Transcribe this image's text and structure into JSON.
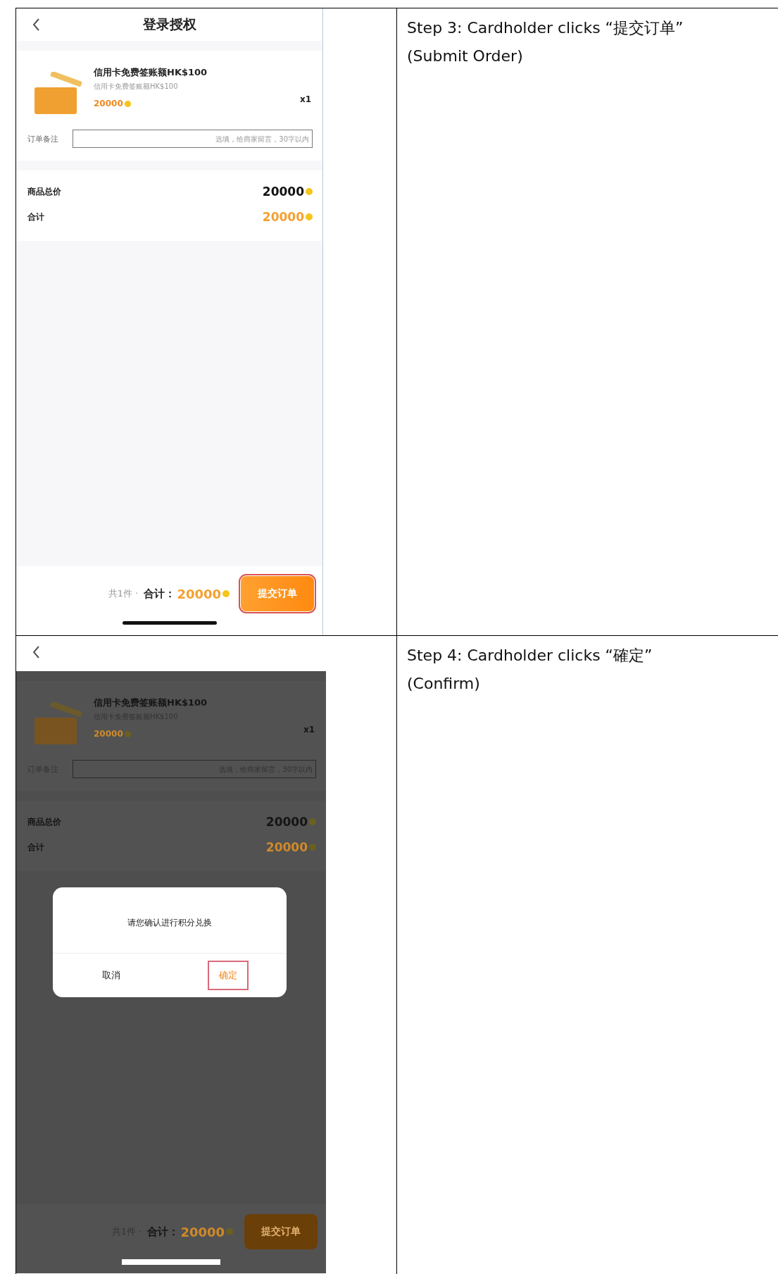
{
  "rows": [
    {
      "step_text": "Step 3: Cardholder clicks “提交订单”",
      "step_note": "(Submit Order)",
      "screen": {
        "title": "登录授权",
        "dimmed": false,
        "product": {
          "name": "信用卡免费签账额HK$100",
          "subtitle": "信用卡免费签账额HK$100",
          "price": "20000",
          "quantity": "x1"
        },
        "remark": {
          "label": "订单备注",
          "placeholder": "选填，给商家留言，30字以内"
        },
        "summary": [
          {
            "label": "商品总价",
            "value": "20000",
            "kind": "subtotal"
          },
          {
            "label": "合计",
            "value": "20000",
            "kind": "total"
          }
        ],
        "footer": {
          "count": "共1件 ·",
          "total_label": "合计：",
          "total": "20000"
        },
        "submit_button": {
          "label": "提交订单",
          "highlighted": true
        }
      }
    },
    {
      "step_text": "Step 4: Cardholder clicks “確定”",
      "step_note": "(Confirm)",
      "screen": {
        "dimmed": true,
        "product": {
          "name": "信用卡免费签账额HK$100",
          "subtitle": "信用卡免费签账额HK$100",
          "price": "20000",
          "quantity": "x1"
        },
        "remark": {
          "label": "订单备注",
          "placeholder": "选填，给商家留言，30字以内"
        },
        "summary": [
          {
            "label": "商品总价",
            "value": "20000",
            "kind": "subtotal"
          },
          {
            "label": "合计",
            "value": "20000",
            "kind": "total"
          }
        ],
        "footer": {
          "count": "共1件 ·",
          "total_label": "合计：",
          "total": "20000"
        },
        "submit_button": {
          "label": "提交订单",
          "highlighted": false
        },
        "dialog": {
          "message": "请您确认进行积分兑换",
          "buttons": [
            {
              "label": "取消",
              "kind": "cancel",
              "highlighted": false
            },
            {
              "label": "确定",
              "kind": "confirm",
              "highlighted": true
            }
          ]
        }
      }
    }
  ]
}
